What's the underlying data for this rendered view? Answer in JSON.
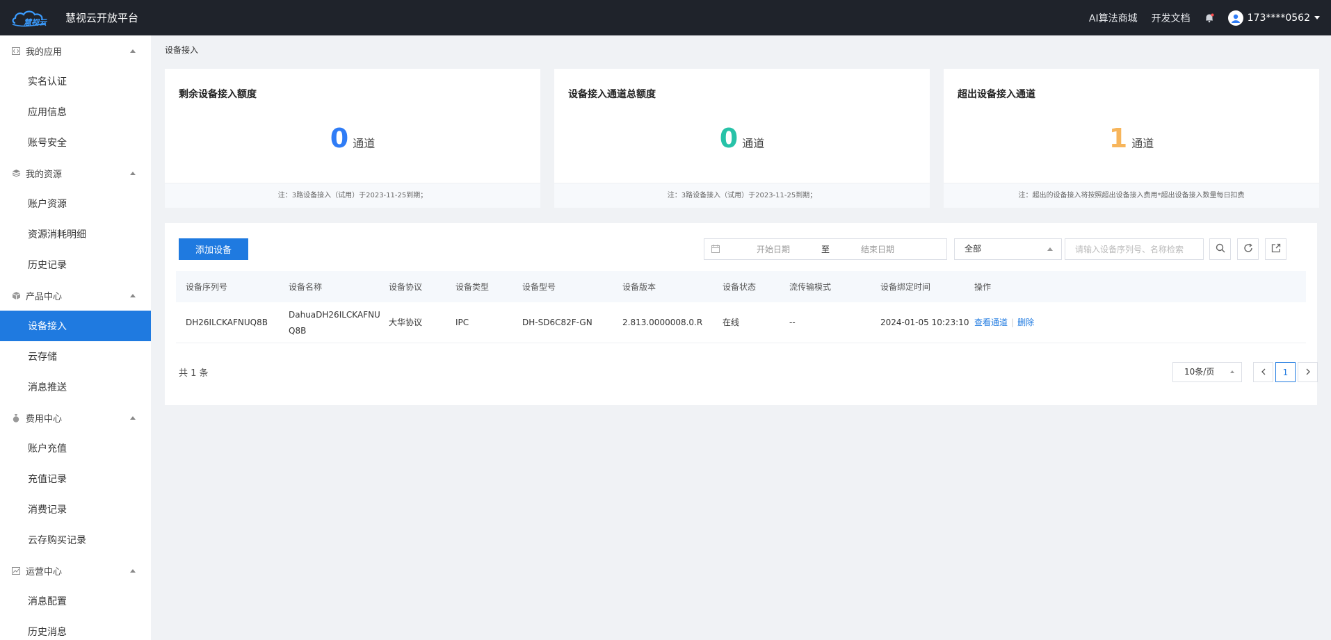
{
  "app": {
    "brand_logo_text": "慧视云",
    "title": "慧视云开放平台"
  },
  "topnav": {
    "links": [
      "AI算法商城",
      "开发文档"
    ],
    "user": "173****0562"
  },
  "sidebar": {
    "groups": [
      {
        "label": "我的应用",
        "icon": "code-icon",
        "items": [
          "实名认证",
          "应用信息",
          "账号安全"
        ]
      },
      {
        "label": "我的资源",
        "icon": "layers-icon",
        "items": [
          "账户资源",
          "资源消耗明细",
          "历史记录"
        ]
      },
      {
        "label": "产品中心",
        "icon": "box-icon",
        "items": [
          "设备接入",
          "云存储",
          "消息推送"
        ]
      },
      {
        "label": "费用中心",
        "icon": "money-bag-icon",
        "items": [
          "账户充值",
          "充值记录",
          "消费记录",
          "云存购买记录"
        ]
      },
      {
        "label": "运营中心",
        "icon": "chart-icon",
        "items": [
          "消息配置",
          "历史消息"
        ]
      }
    ],
    "active": "设备接入"
  },
  "breadcrumb": "设备接入",
  "cards": [
    {
      "title": "剩余设备接入额度",
      "value": "0",
      "unit": "通道",
      "color": "#2f7cf6",
      "note": "注：3路设备接入（试用）于2023-11-25到期；"
    },
    {
      "title": "设备接入通道总额度",
      "value": "0",
      "unit": "通道",
      "color": "#27c2a8",
      "note": "注：3路设备接入（试用）于2023-11-25到期；"
    },
    {
      "title": "超出设备接入通道",
      "value": "1",
      "unit": "通道",
      "color": "#f7b55b",
      "note": "注：超出的设备接入将按照超出设备接入费用*超出设备接入数量每日扣费"
    }
  ],
  "toolbar": {
    "add_label": "添加设备",
    "date_start_placeholder": "开始日期",
    "date_separator": "至",
    "date_end_placeholder": "结束日期",
    "filter_value": "全部",
    "search_placeholder": "请输入设备序列号、名称检索"
  },
  "table": {
    "columns": [
      "设备序列号",
      "设备名称",
      "设备协议",
      "设备类型",
      "设备型号",
      "设备版本",
      "设备状态",
      "流传输模式",
      "设备绑定时间",
      "操作"
    ],
    "rows": [
      {
        "serial": "DH26ILCKAFNUQ8B",
        "name_line1": "DahuaDH26ILCKAFNU",
        "name_line2": "Q8B",
        "protocol": "大华协议",
        "type": "IPC",
        "model": "DH-SD6C82F-GN",
        "version": "2.813.0000008.0.R",
        "status": "在线",
        "stream_mode": "--",
        "bind_time": "2024-01-05 10:23:10",
        "action_view": "查看通道",
        "action_delete": "删除"
      }
    ]
  },
  "pagination": {
    "total_text": "共 1 条",
    "page_size": "10条/页",
    "current_page": "1"
  }
}
